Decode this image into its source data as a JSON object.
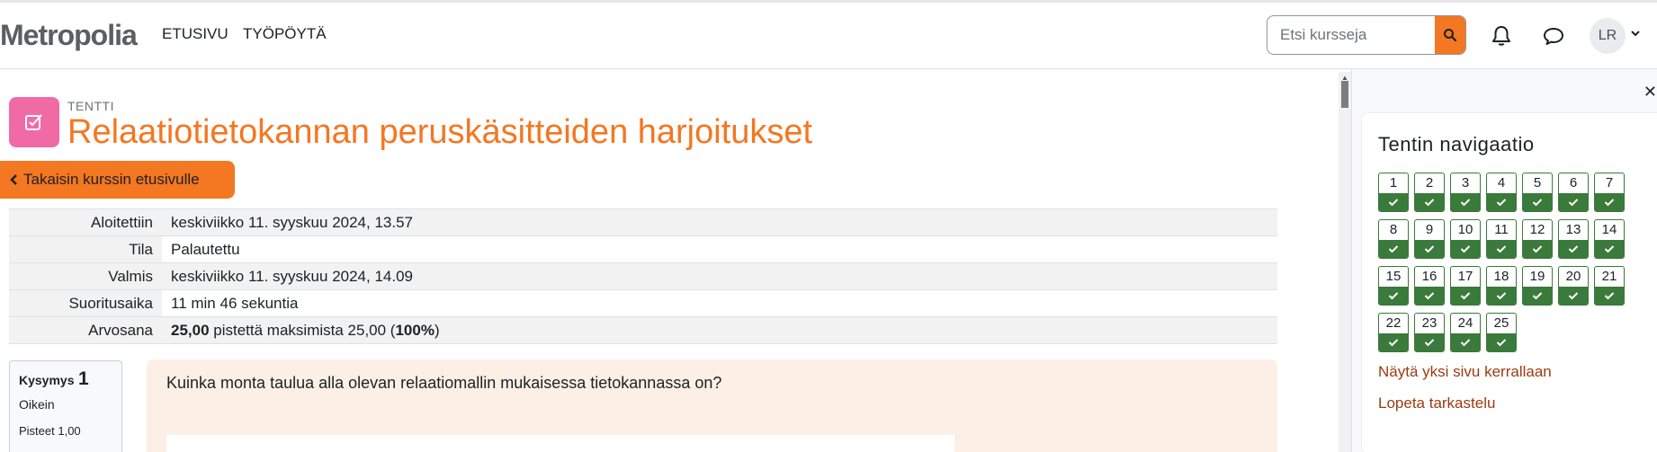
{
  "header": {
    "brand": "Metropolia",
    "nav": [
      "ETUSIVU",
      "TYÖPÖYTÄ"
    ],
    "search_placeholder": "Etsi kursseja",
    "avatar_initials": "LR"
  },
  "activity": {
    "type": "TENTTI",
    "title": "Relaatiotietokannan peruskäsitteiden harjoitukset",
    "back_button": "Takaisin kurssin etusivulle"
  },
  "summary": [
    {
      "label": "Aloitettiin",
      "value": "keskiviikko 11. syyskuu 2024, 13.57"
    },
    {
      "label": "Tila",
      "value": "Palautettu"
    },
    {
      "label": "Valmis",
      "value": "keskiviikko 11. syyskuu 2024, 14.09"
    },
    {
      "label": "Suoritusaika",
      "value": "11 min 46 sekuntia"
    },
    {
      "label": "Arvosana",
      "value_bold": "25,00",
      "value_mid": " pistettä maksimista 25,00 (",
      "value_pct": "100%",
      "value_end": ")"
    }
  ],
  "question": {
    "label": "Kysymys",
    "number": "1",
    "state": "Oikein",
    "grade": "Pisteet 1,00",
    "text": "Kuinka monta taulua alla olevan relaatiomallin mukaisessa tietokannassa on?"
  },
  "drawer": {
    "title": "Tentin navigaatio",
    "questions": [
      "1",
      "2",
      "3",
      "4",
      "5",
      "6",
      "7",
      "8",
      "9",
      "10",
      "11",
      "12",
      "13",
      "14",
      "15",
      "16",
      "17",
      "18",
      "19",
      "20",
      "21",
      "22",
      "23",
      "24",
      "25"
    ],
    "status": "correct",
    "link_single_page": "Näytä yksi sivu kerrallaan",
    "link_finish": "Lopeta tarkastelu"
  },
  "colors": {
    "brand_orange": "#f47721",
    "activity_pink": "#f06aa5",
    "correct_green": "#3a7a3a",
    "link_brown": "#9b3b10"
  }
}
